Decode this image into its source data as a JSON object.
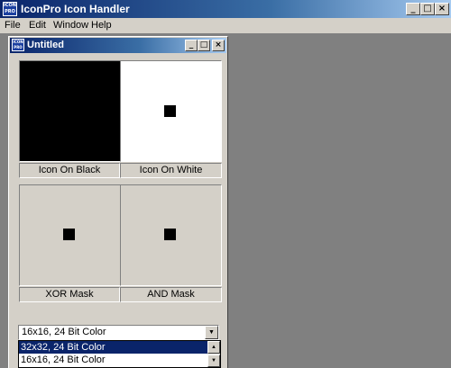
{
  "app": {
    "title": "IconPro Icon Handler",
    "icon_text": "ICON PRO"
  },
  "menu": {
    "items": [
      "File",
      "Edit",
      "Window",
      "Help"
    ]
  },
  "caption_buttons": {
    "minimize": "_",
    "maximize": "□",
    "close": "×"
  },
  "child_window": {
    "title": "Untitled",
    "icon_text": "ICON PRO"
  },
  "panels": {
    "icon_on_black": "Icon On Black",
    "icon_on_white": "Icon On White",
    "xor_mask": "XOR Mask",
    "and_mask": "AND Mask"
  },
  "format_select": {
    "value": "16x16, 24 Bit Color",
    "options": [
      "32x32, 24 Bit Color",
      "16x16, 24 Bit Color"
    ],
    "highlighted_option": "32x32, 24 Bit Color"
  },
  "colors": {
    "title_active": "#0a246a",
    "face": "#d4d0c8",
    "mdi_background": "#808080",
    "selection": "#0a246a"
  }
}
